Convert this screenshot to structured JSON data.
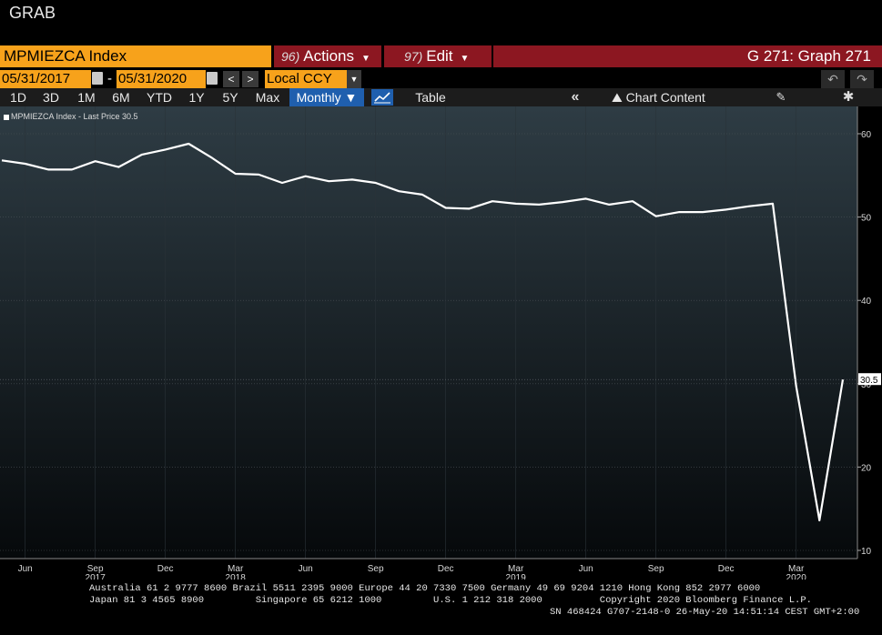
{
  "window": {
    "title": "GRAB"
  },
  "toolbar": {
    "ticker": "MPMIEZCA Index",
    "actions_num": "96)",
    "actions_label": "Actions",
    "edit_num": "97)",
    "edit_label": "Edit",
    "graph_title": "G 271: Graph 271"
  },
  "range": {
    "start_date": "05/31/2017",
    "separator": "-",
    "end_date": "05/31/2020",
    "prev": "<",
    "next": ">",
    "currency": "Local CCY"
  },
  "periods": [
    "1D",
    "3D",
    "1M",
    "6M",
    "YTD",
    "1Y",
    "5Y",
    "Max"
  ],
  "frequency": "Monthly",
  "table_label": "Table",
  "chart_content_label": "Chart Content",
  "legend": {
    "label": "MPMIEZCA Index - Last Price 30.5"
  },
  "colors": {
    "brand_orange": "#f7a21b",
    "menu_red": "#8c1721",
    "active_blue": "#1f5fae",
    "line": "#ffffff"
  },
  "chart_data": {
    "type": "line",
    "series": [
      {
        "name": "MPMIEZCA Index - Last Price",
        "x": [
          "2017-05",
          "2017-06",
          "2017-07",
          "2017-08",
          "2017-09",
          "2017-10",
          "2017-11",
          "2017-12",
          "2018-01",
          "2018-02",
          "2018-03",
          "2018-04",
          "2018-05",
          "2018-06",
          "2018-07",
          "2018-08",
          "2018-09",
          "2018-10",
          "2018-11",
          "2018-12",
          "2019-01",
          "2019-02",
          "2019-03",
          "2019-04",
          "2019-05",
          "2019-06",
          "2019-07",
          "2019-08",
          "2019-09",
          "2019-10",
          "2019-11",
          "2019-12",
          "2020-01",
          "2020-02",
          "2020-03",
          "2020-04",
          "2020-05"
        ],
        "values": [
          56.8,
          56.4,
          55.7,
          55.7,
          56.7,
          56.0,
          57.5,
          58.1,
          58.8,
          57.1,
          55.2,
          55.1,
          54.1,
          54.9,
          54.3,
          54.5,
          54.1,
          53.1,
          52.7,
          51.1,
          51.0,
          51.9,
          51.6,
          51.5,
          51.8,
          52.2,
          51.5,
          51.9,
          50.1,
          50.6,
          50.6,
          50.9,
          51.3,
          51.6,
          29.7,
          13.6,
          30.5
        ]
      }
    ],
    "last_value": "30.5",
    "ylim": [
      10,
      62
    ],
    "yticks": [
      10,
      20,
      30,
      40,
      50,
      60
    ],
    "ytick_labels": [
      "10",
      "20",
      "30",
      "40",
      "50",
      "60"
    ],
    "xtick_labels": [
      "Jun",
      "Sep",
      "Dec",
      "Mar",
      "Jun",
      "Sep",
      "Dec",
      "Mar",
      "Jun",
      "Sep",
      "Dec",
      "Mar"
    ],
    "xtick_months": [
      "2017-06",
      "2017-09",
      "2017-12",
      "2018-03",
      "2018-06",
      "2018-09",
      "2018-12",
      "2019-03",
      "2019-06",
      "2019-09",
      "2019-12",
      "2020-03"
    ],
    "year_labels": [
      "2017",
      "2018",
      "2019",
      "2020"
    ],
    "year_months": [
      "2017-09",
      "2018-03",
      "2019-03",
      "2020-03"
    ],
    "grid": true
  },
  "footer": {
    "line1": "Australia 61 2 9777 8600 Brazil 5511 2395 9000 Europe 44 20 7330 7500 Germany 49 69 9204 1210 Hong Kong 852 2977 6000",
    "line2": "Japan 81 3 4565 8900         Singapore 65 6212 1000         U.S. 1 212 318 2000          Copyright 2020 Bloomberg Finance L.P.",
    "line3": "SN 468424 G707-2148-0 26-May-20 14:51:14 CEST GMT+2:00"
  }
}
